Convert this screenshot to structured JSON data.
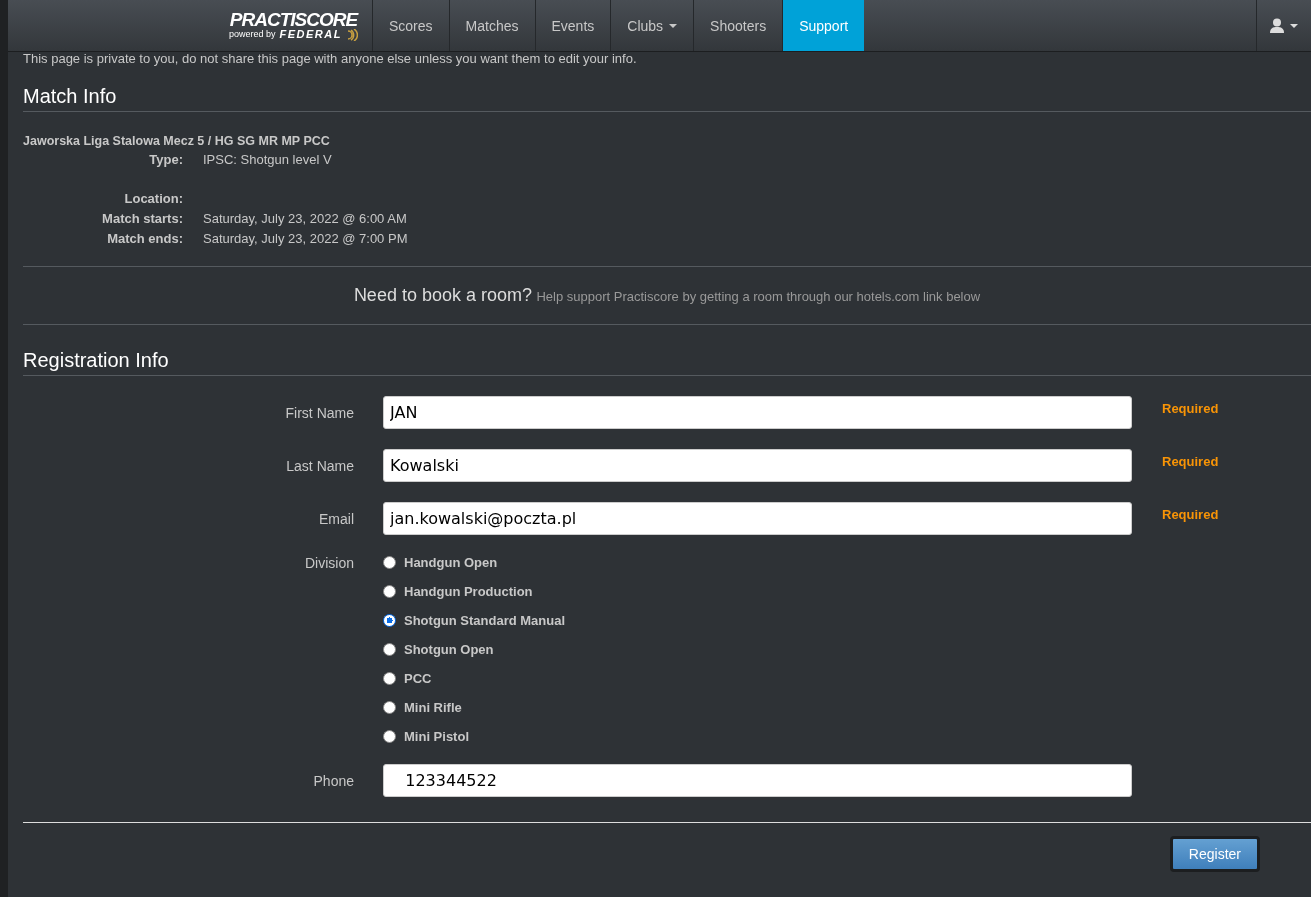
{
  "navbar": {
    "logo": {
      "brand": "PRACTISCORE",
      "tagline": "powered by",
      "partner": "FEDERAL"
    },
    "items": [
      {
        "label": "Scores",
        "selected": false,
        "dropdown": false
      },
      {
        "label": "Matches",
        "selected": false,
        "dropdown": false
      },
      {
        "label": "Events",
        "selected": false,
        "dropdown": false
      },
      {
        "label": "Clubs",
        "selected": false,
        "dropdown": true
      },
      {
        "label": "Shooters",
        "selected": false,
        "dropdown": false
      },
      {
        "label": "Support",
        "selected": true,
        "dropdown": false
      }
    ]
  },
  "notice": "This page is private to you, do not share this page with anyone else unless you want them to edit your info.",
  "match_info": {
    "heading": "Match Info",
    "name": "Jaworska Liga Stalowa Mecz 5 / HG SG MR MP PCC",
    "details": [
      {
        "label": "Type:",
        "value": "IPSC: Shotgun level V"
      },
      {
        "label": "Location:"
      },
      {
        "label": "Match starts:",
        "value": "Saturday, July 23, 2022 @ 6:00 AM"
      },
      {
        "label": "Match ends:",
        "value": "Saturday, July 23, 2022 @ 7:00 PM"
      }
    ]
  },
  "hotel": {
    "title": "Need to book a room?",
    "text": "Help support Practiscore by getting a room through our hotels.com link below"
  },
  "registration": {
    "heading": "Registration Info",
    "fields": [
      {
        "label": "First Name",
        "value": "JAN",
        "required": "Required"
      },
      {
        "label": "Last Name",
        "value": "Kowalski",
        "required": "Required"
      },
      {
        "label": "Email",
        "value": "jan.kowalski@poczta.pl",
        "required": "Required"
      }
    ],
    "division": {
      "label": "Division",
      "options": [
        {
          "label": "Handgun Open",
          "selected": false
        },
        {
          "label": "Handgun Production",
          "selected": false
        },
        {
          "label": "Shotgun Standard Manual",
          "selected": true
        },
        {
          "label": "Shotgun Open",
          "selected": false
        },
        {
          "label": "PCC",
          "selected": false
        },
        {
          "label": "Mini Rifle",
          "selected": false
        },
        {
          "label": "Mini Pistol",
          "selected": false
        }
      ]
    },
    "phone": {
      "label": "Phone",
      "value": "   123344522"
    },
    "submit": "Register"
  }
}
